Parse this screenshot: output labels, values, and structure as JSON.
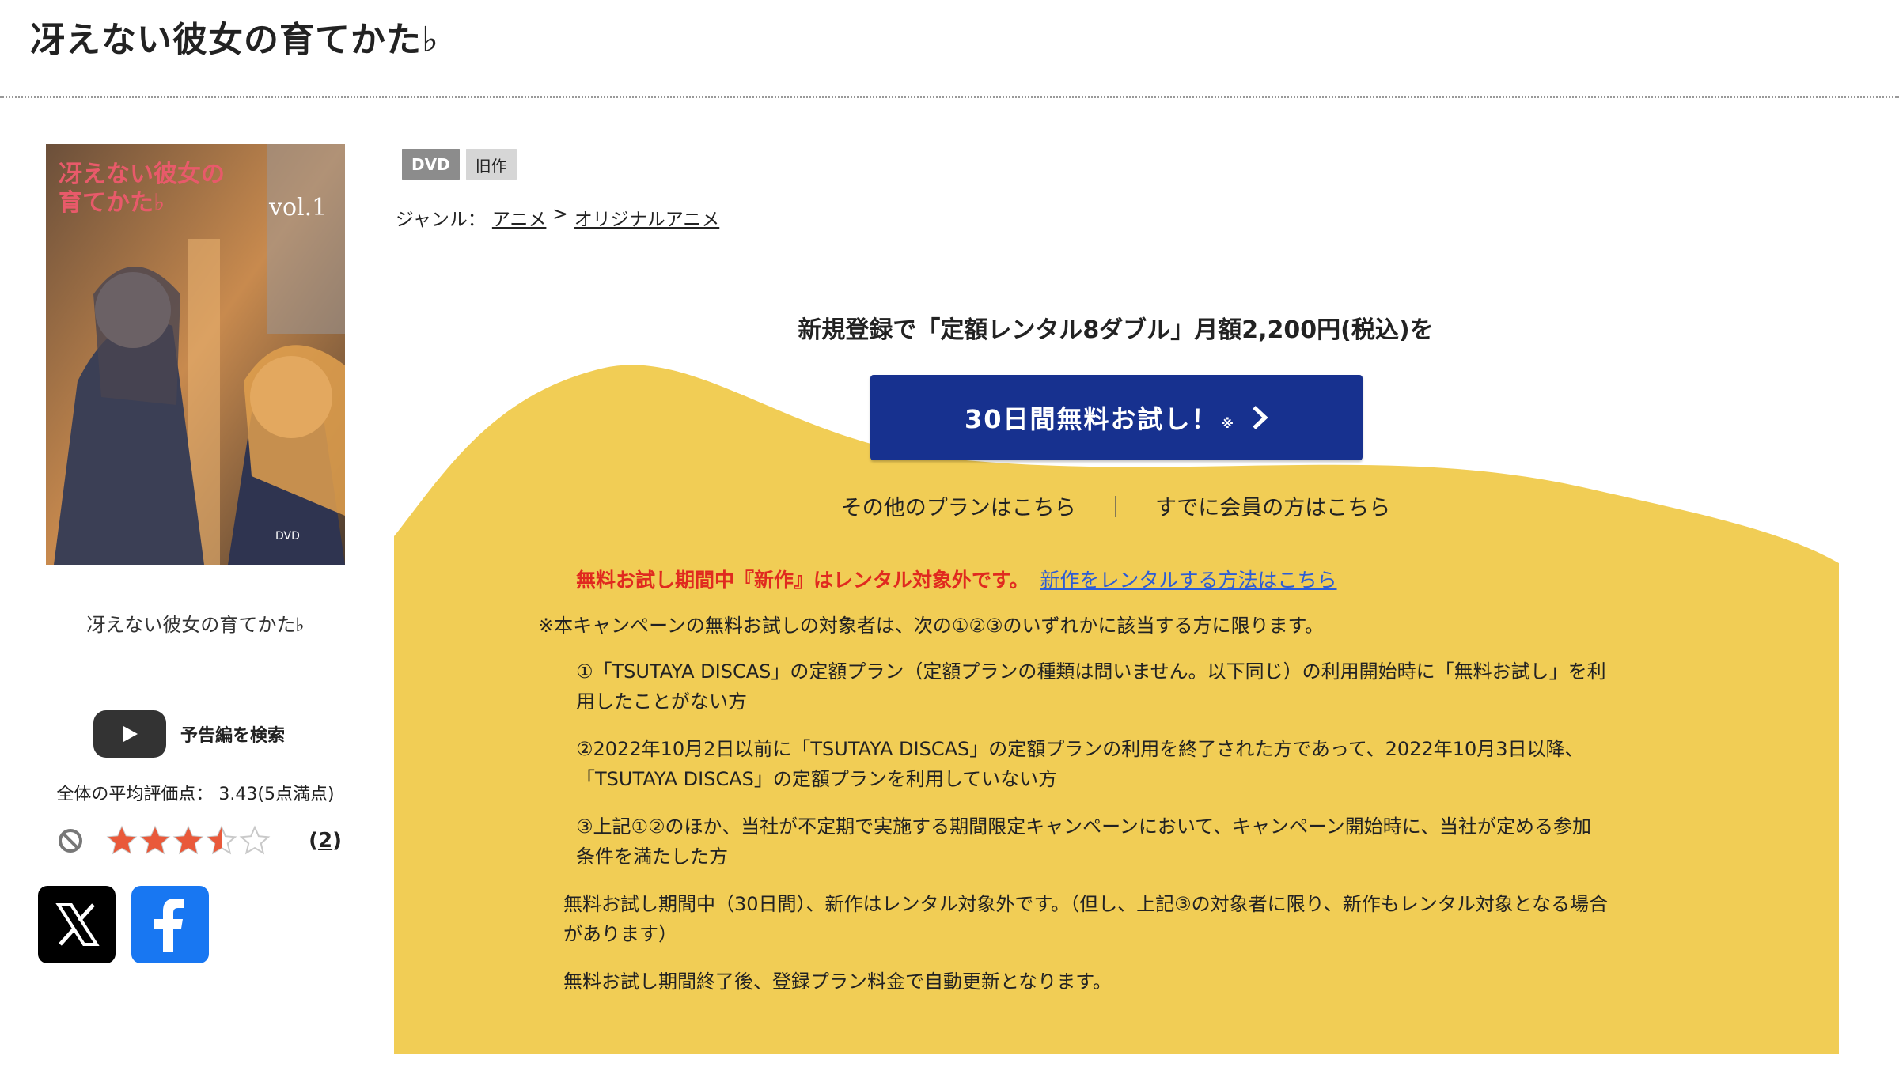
{
  "page_title": "冴えない彼女の育てかた♭",
  "product": {
    "cover_caption": "冴えない彼女の育てかた♭",
    "trailer_label": "予告編を検索",
    "rating_text": "全体の平均評価点： 3.43(5点満点)",
    "rating_value": 3.43,
    "rating_max": 5,
    "review_count": "2",
    "review_open": "(",
    "review_close": ")"
  },
  "badges": {
    "format": "DVD",
    "status": "旧作"
  },
  "genre": {
    "label": "ジャンル：",
    "items": [
      "アニメ",
      "オリジナルアニメ"
    ],
    "separator": ">"
  },
  "promo": {
    "headline": "新規登録で「定額レンタル8ダブル」月額2,200円(税込)を",
    "cta_label": "30日間無料お試し！",
    "cta_mark": "※",
    "other_plans": "その他のプランはこちら",
    "link_separator": "｜",
    "members_link": "すでに会員の方はこちら",
    "warning": "無料お試し期間中『新作』はレンタル対象外です。",
    "warning_link": "新作をレンタルする方法はこちら",
    "terms_intro": "※本キャンペーンの無料お試しの対象者は、次の①②③のいずれかに該当する方に限ります。",
    "term1_line1": "①「TSUTAYA DISCAS」の定額プラン（定額プランの種類は問いません。以下同じ）の利用開始時に「無料お試し」を利",
    "term1_line2": "用したことがない方",
    "term2_line1": "②2022年10月2日以前に「TSUTAYA DISCAS」の定額プランの利用を終了された方であって、2022年10月3日以降、",
    "term2_line2": "「TSUTAYA DISCAS」の定額プランを利用していない方",
    "term3_line1": "③上記①②のほか、当社が不定期で実施する期間限定キャンペーンにおいて、キャンペーン開始時に、当社が定める参加",
    "term3_line2": "条件を満たした方",
    "note1_line1": "無料お試し期間中（30日間）、新作はレンタル対象外です。（但し、上記③の対象者に限り、新作もレンタル対象となる場合",
    "note1_line2": "があります）",
    "note2": "無料お試し期間終了後、登録プラン料金で自動更新となります。"
  },
  "colors": {
    "promo_yellow": "#f1cd55",
    "cta_blue": "#17318f",
    "warning_red": "#e02a1f",
    "link_blue": "#2c5cd6",
    "star_orange": "#e9593a"
  }
}
